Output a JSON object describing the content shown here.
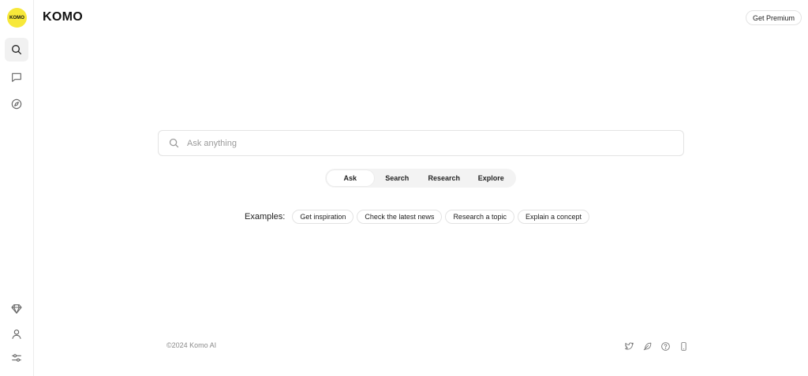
{
  "logo": {
    "badge_text": "KOMO"
  },
  "header": {
    "brand": "KOMO",
    "premium_label": "Get Premium"
  },
  "sidebar": {
    "top_items": [
      {
        "name": "search",
        "icon": "search-icon",
        "active": true
      },
      {
        "name": "chat",
        "icon": "chat-bubble-icon",
        "active": false
      },
      {
        "name": "explore",
        "icon": "compass-icon",
        "active": false
      }
    ],
    "bottom_items": [
      {
        "name": "premium",
        "icon": "diamond-icon"
      },
      {
        "name": "profile",
        "icon": "user-icon"
      },
      {
        "name": "settings",
        "icon": "sliders-icon"
      }
    ]
  },
  "search": {
    "placeholder": "Ask anything",
    "value": ""
  },
  "modes": {
    "tabs": [
      "Ask",
      "Search",
      "Research",
      "Explore"
    ],
    "active": "Ask"
  },
  "examples": {
    "label": "Examples:",
    "chips": [
      "Get inspiration",
      "Check the latest news",
      "Research a topic",
      "Explain a concept"
    ]
  },
  "footer": {
    "copyright": "©2024 Komo AI",
    "icons": [
      "twitter-icon",
      "feather-icon",
      "help-icon",
      "mobile-icon"
    ]
  },
  "colors": {
    "accent_yellow": "#f7e83a",
    "border": "#e3e3e3",
    "tab_bg": "#f3f3f3"
  }
}
